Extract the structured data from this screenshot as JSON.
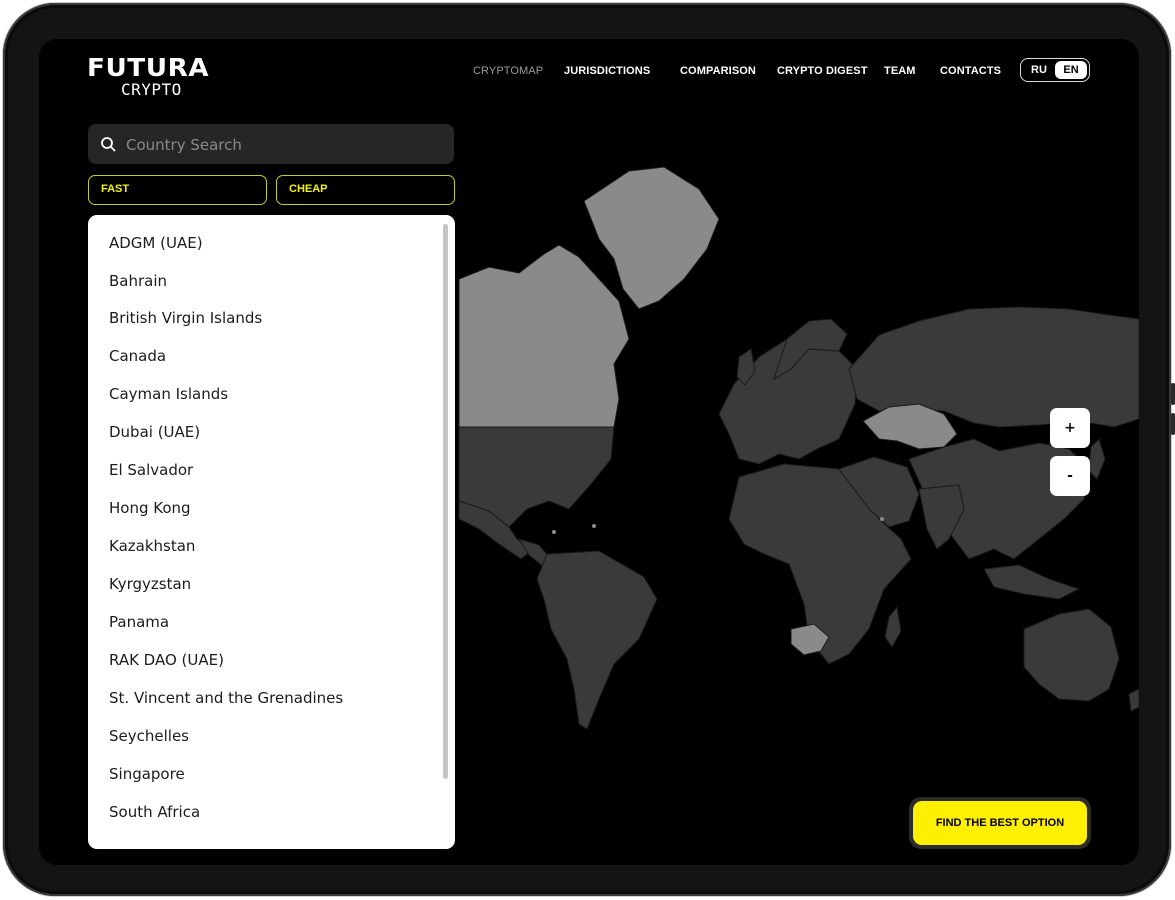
{
  "brand": {
    "line1": "FUTURA",
    "line2": "CRYPTO"
  },
  "nav": {
    "items": [
      {
        "label": "CRYPTOMAP",
        "active": true
      },
      {
        "label": "JURISDICTIONS"
      },
      {
        "label": "COMPARISON"
      },
      {
        "label": "CRYPTO DIGEST"
      },
      {
        "label": "TEAM"
      },
      {
        "label": "CONTACTS"
      }
    ]
  },
  "lang": {
    "ru": "RU",
    "en": "EN",
    "selected": "EN"
  },
  "search": {
    "placeholder": "Country Search",
    "value": "",
    "icon": "search-icon"
  },
  "filters": {
    "fast": "FAST",
    "cheap": "CHEAP"
  },
  "countries": [
    "ADGM (UAE)",
    "Bahrain",
    "British Virgin Islands",
    "Canada",
    "Cayman Islands",
    "Dubai (UAE)",
    "El Salvador",
    "Hong Kong",
    "Kazakhstan",
    "Kyrgyzstan",
    "Panama",
    "RAK DAO (UAE)",
    "St. Vincent and the Grenadines",
    "Seychelles",
    "Singapore",
    "South Africa"
  ],
  "zoom": {
    "in": "+",
    "out": "-"
  },
  "cta": {
    "label": "FIND THE BEST OPTION"
  },
  "colors": {
    "accent": "#FFEF00",
    "filter_border": "#C8CC1E",
    "background": "#000000",
    "map_country": "#3B3B3B",
    "map_highlight": "#8A8A8A"
  }
}
